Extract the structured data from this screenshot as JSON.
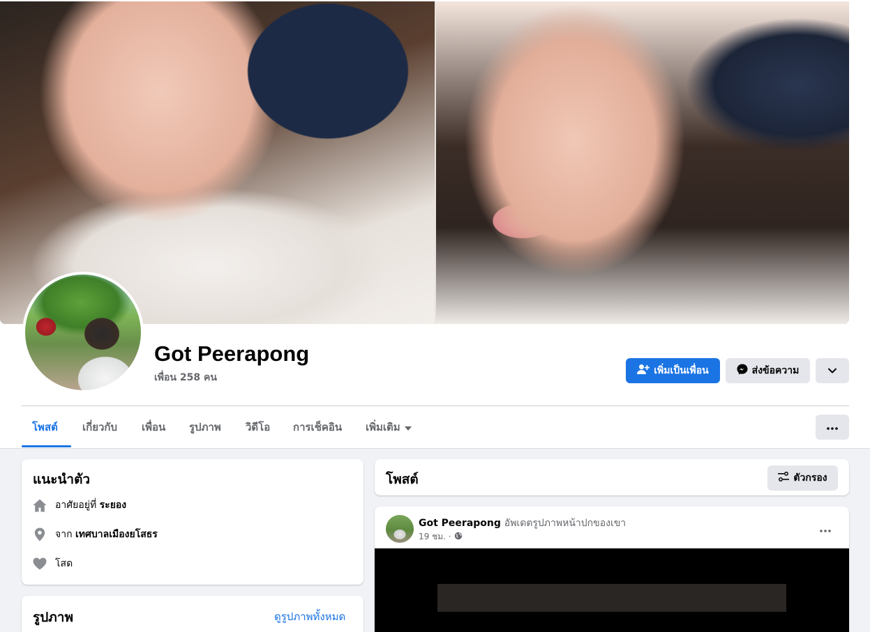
{
  "profile": {
    "name": "Got Peerapong",
    "friends": "เพื่อน 258 คน"
  },
  "actions": {
    "add_friend": "เพิ่มเป็นเพื่อน",
    "message": "ส่งข้อความ"
  },
  "tabs": [
    {
      "label": "โพสต์"
    },
    {
      "label": "เกี่ยวกับ"
    },
    {
      "label": "เพื่อน"
    },
    {
      "label": "รูปภาพ"
    },
    {
      "label": "วิดีโอ"
    },
    {
      "label": "การเช็คอิน"
    },
    {
      "label": "เพิ่มเติม"
    }
  ],
  "intro": {
    "title": "แนะนำตัว",
    "lives_prefix": "อาศัยอยู่ที่",
    "lives_value": "ระยอง",
    "from_prefix": "จาก",
    "from_value": "เทศบาลเมืองยโสธร",
    "relationship": "โสด"
  },
  "photos": {
    "title": "รูปภาพ",
    "see_all": "ดูรูปภาพทั้งหมด"
  },
  "posts": {
    "title": "โพสต์",
    "filter": "ตัวกรอง"
  },
  "post": {
    "author": "Got Peerapong",
    "action": "อัพเดตรูปภาพหน้าปกของเขา",
    "time": "19 ชม. ·"
  },
  "colors": {
    "accent": "#1b74e4",
    "background": "#f0f2f5",
    "button_gray": "#e4e6eb",
    "text_secondary": "#65676b"
  },
  "icons": {
    "add_friend": "add-friend-icon",
    "message": "messenger-icon",
    "more": "chevron-down-icon",
    "dots": "more-dots-icon",
    "home": "home-icon",
    "location": "location-pin-icon",
    "heart": "heart-icon",
    "filter": "filter-icon",
    "globe": "globe-icon",
    "dropdown": "caret-down-icon"
  }
}
